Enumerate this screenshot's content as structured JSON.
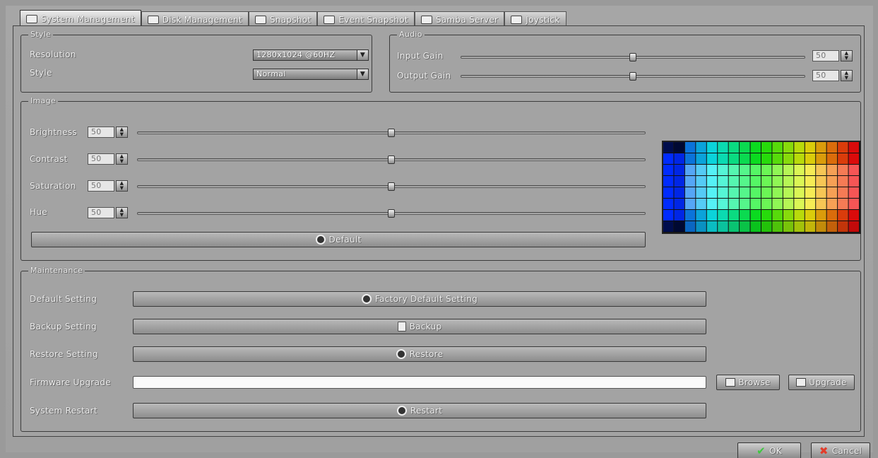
{
  "tabs": [
    {
      "label": "System Management",
      "icon": "system-icon"
    },
    {
      "label": "Disk Management",
      "icon": "disk-icon"
    },
    {
      "label": "Snapshot",
      "icon": "snapshot-icon"
    },
    {
      "label": "Event Snapshot",
      "icon": "event-snapshot-icon"
    },
    {
      "label": "Samba Server",
      "icon": "samba-icon"
    },
    {
      "label": "Joystick",
      "icon": "joystick-icon"
    }
  ],
  "style_group": {
    "legend": "Style",
    "resolution_label": "Resolution",
    "resolution_value": "1280x1024 @60HZ",
    "style_label": "Style",
    "style_value": "Normal"
  },
  "audio_group": {
    "legend": "Audio",
    "input_gain_label": "Input Gain",
    "input_gain_value": "50",
    "input_gain_level": 0.5,
    "output_gain_label": "Output Gain",
    "output_gain_value": "50",
    "output_gain_level": 0.5
  },
  "image_group": {
    "legend": "Image",
    "brightness_label": "Brightness",
    "brightness_value": "50",
    "contrast_label": "Contrast",
    "contrast_value": "50",
    "saturation_label": "Saturation",
    "saturation_value": "50",
    "hue_label": "Hue",
    "hue_value": "50",
    "level": 0.5,
    "default_button": "Default"
  },
  "maintenance": {
    "legend": "Maintenance",
    "default_setting_label": "Default Setting",
    "factory_default_button": "Factory Default Setting",
    "backup_setting_label": "Backup Setting",
    "backup_button": "Backup",
    "restore_setting_label": "Restore Setting",
    "restore_button": "Restore",
    "firmware_upgrade_label": "Firmware Upgrade",
    "firmware_path": "",
    "browse_button": "Browse",
    "upgrade_button": "Upgrade",
    "system_restart_label": "System Restart",
    "restart_button": "Restart"
  },
  "footer": {
    "ok": "OK",
    "cancel": "Cancel"
  },
  "colors": {
    "ok_check": "#3ec83e",
    "cancel_x": "#e23c2a"
  }
}
